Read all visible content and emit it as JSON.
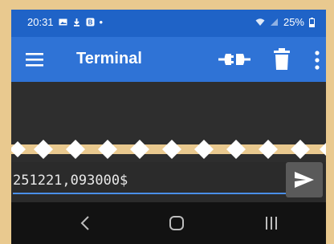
{
  "status_bar": {
    "time": "20:31",
    "dot": "•",
    "battery": "25%",
    "left_icons": [
      "image-icon",
      "download-icon",
      "notification-icon"
    ],
    "right_icons": [
      "wifi-icon",
      "signal-icon",
      "battery-icon"
    ]
  },
  "app_bar": {
    "title": "Terminal",
    "icons": [
      "menu-icon",
      "connect-icon",
      "delete-icon",
      "more-vert-icon"
    ]
  },
  "input": {
    "value": "251221,093000$"
  },
  "send": {
    "icon": "send-icon"
  },
  "nav": {
    "icons": [
      "back-icon",
      "home-icon",
      "recents-icon"
    ]
  },
  "colors": {
    "status_bar": "#1f63c7",
    "app_bar": "#2f73d6",
    "terminal_bg": "#2e2e2e",
    "accent": "#4a8fe8",
    "send_button": "#5a5a5a",
    "nav_bar": "#121212",
    "backdrop": "#e9c98f"
  }
}
